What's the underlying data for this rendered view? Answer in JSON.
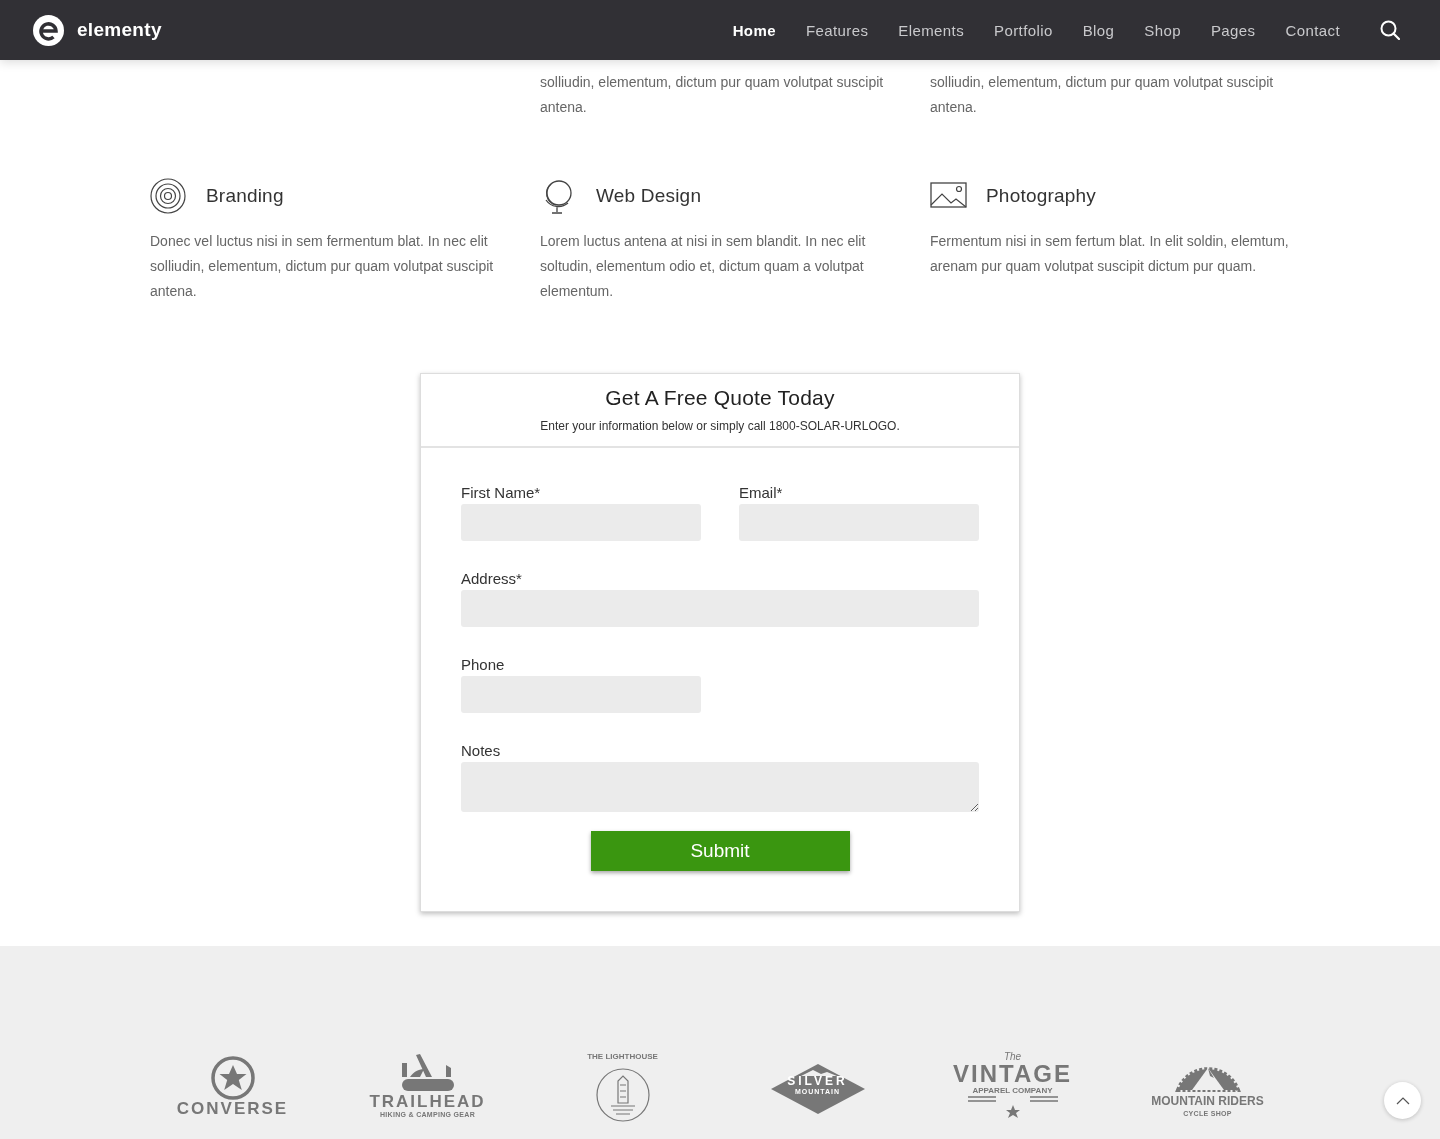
{
  "nav": {
    "brand": "elementy",
    "items": [
      {
        "label": "Home",
        "selected": true
      },
      {
        "label": "Features",
        "selected": false
      },
      {
        "label": "Elements",
        "selected": false
      },
      {
        "label": "Portfolio",
        "selected": false
      },
      {
        "label": "Blog",
        "selected": false
      },
      {
        "label": "Shop",
        "selected": false
      },
      {
        "label": "Pages",
        "selected": false
      },
      {
        "label": "Contact",
        "selected": false
      }
    ]
  },
  "cut_services": [
    {
      "text": "solliudin, elementum, dictum pur quam volutpat suscipit antena."
    },
    {
      "text": "solliudin, elementum, dictum pur quam volutpat suscipit antena."
    }
  ],
  "services": [
    {
      "kind": "rings",
      "title": "Branding",
      "text": "Donec vel luctus nisi in sem fermentum blat. In nec elit solliudin, elementum, dictum pur quam volutpat suscipit antena."
    },
    {
      "kind": "globe",
      "title": "Web Design",
      "text": "Lorem luctus antena at nisi in sem blandit. In nec elit soltudin, elementum odio et, dictum quam a volutpat elementum."
    },
    {
      "kind": "image",
      "title": "Photography",
      "text": "Fermentum nisi in sem fertum blat. In elit soldin, elemtum, arenam pur quam volutpat suscipit dictum pur quam."
    }
  ],
  "quote_form": {
    "title": "Get A Free Quote Today",
    "subtitle": "Enter your information below or simply call 1800-SOLAR-URLOGO.",
    "fields": [
      {
        "kind": "half",
        "label": "First Name*"
      },
      {
        "kind": "half",
        "label": "Email*"
      },
      {
        "kind": "full",
        "label": "Address*"
      },
      {
        "kind": "half",
        "label": "Phone"
      },
      {
        "kind": "area",
        "label": "Notes"
      }
    ],
    "submit": "Submit"
  },
  "logos": [
    {
      "kind": "star",
      "texts": [
        "CONVERSE"
      ]
    },
    {
      "kind": "knife",
      "texts": [
        "TRAILHEAD",
        "HIKING & CAMPING GEAR"
      ]
    },
    {
      "kind": "lighthouse",
      "texts": [
        "THE LIGHTHOUSE"
      ]
    },
    {
      "kind": "diamond",
      "texts": [
        "SILVER",
        "MOUNTAIN"
      ]
    },
    {
      "kind": "vintage",
      "texts": [
        "The",
        "VINTAGE",
        "APPAREL COMPANY"
      ]
    },
    {
      "kind": "gear",
      "texts": [
        "MOUNTAIN RIDERS",
        "CYCLE SHOP"
      ]
    }
  ]
}
